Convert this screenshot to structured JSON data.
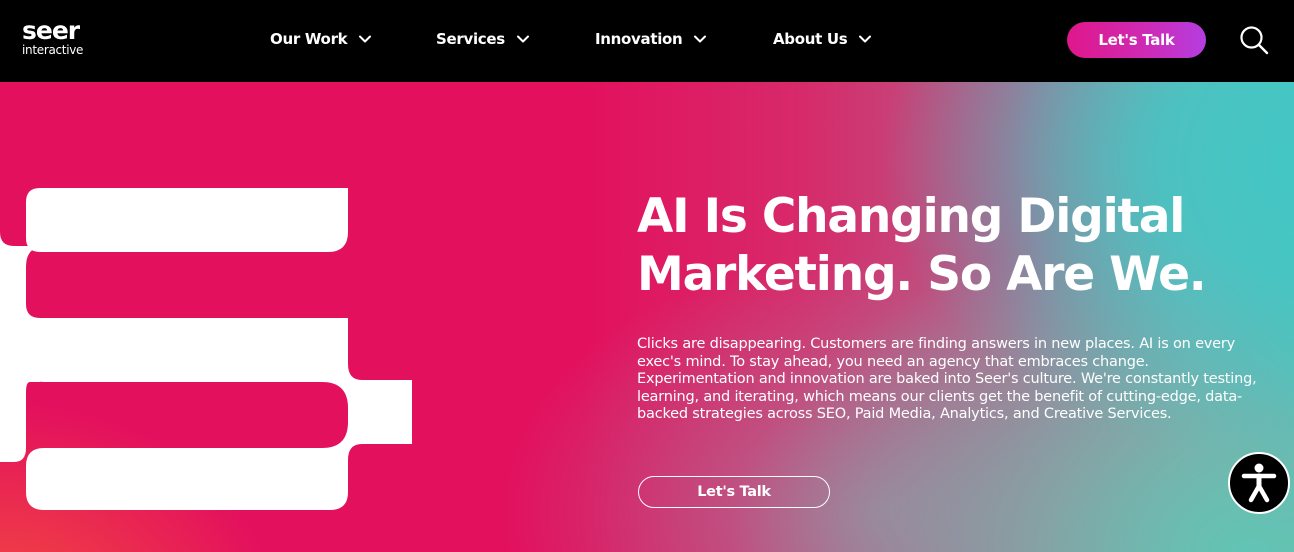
{
  "brand": {
    "name": "seer",
    "sub": "interactive"
  },
  "nav": {
    "items": [
      {
        "label": "Our Work"
      },
      {
        "label": "Services"
      },
      {
        "label": "Innovation"
      },
      {
        "label": "About Us"
      }
    ],
    "cta_label": "Let's Talk",
    "search_icon": "search-icon"
  },
  "hero": {
    "headline": "AI Is Changing Digital Marketing. So Are We.",
    "body": "Clicks are disappearing. Customers are finding answers in new places. AI is on every exec's mind. To stay ahead, you need an agency that embraces change. Experimentation and innovation are baked into Seer's culture. We're constantly testing, learning, and iterating, which means our clients get the benefit of cutting-edge, data-backed strategies across SEO, Paid Media, Analytics, and Creative Services.",
    "cta_label": "Let's Talk"
  },
  "accessibility": {
    "icon": "accessibility-icon"
  },
  "colors": {
    "header_bg": "#000000",
    "hero_pink": "#e3105e",
    "hero_teal": "#4fc3bf",
    "cta_gradient_start": "#e0178a",
    "cta_gradient_end": "#b43ee0",
    "text": "#ffffff"
  }
}
